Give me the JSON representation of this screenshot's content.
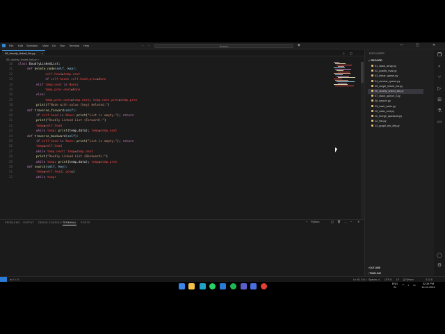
{
  "menu": [
    "File",
    "Edit",
    "Selection",
    "View",
    "Go",
    "Run",
    "Terminal",
    "Help"
  ],
  "search": {
    "placeholder": "Search"
  },
  "tab": {
    "label": "06_doubly_linked_list.py",
    "close": "×"
  },
  "breadcrumb": "06_doubly_linked_list.py > ...",
  "code_lines": [
    {
      "n": "10",
      "indent": 0,
      "segs": [
        [
          "class ",
          "#c586c0"
        ],
        [
          "DoublyLinkedList",
          ""
        ],
        [
          ":",
          "#e6e6e6"
        ]
      ]
    },
    {
      "n": "11",
      "indent": 1,
      "segs": [
        [
          "def ",
          "#c586c0"
        ],
        [
          "delete_node",
          "#dcdcaa"
        ],
        [
          "(self, key):",
          "#9cdcfe"
        ]
      ]
    },
    {
      "n": "12",
      "indent": 3,
      "segs": [
        [
          "self.head",
          "#f44747"
        ],
        [
          "=",
          "#e6e6e6"
        ],
        [
          "temp.next",
          "#f44747"
        ]
      ]
    },
    {
      "n": "13",
      "indent": 3,
      "segs": [
        [
          "if ",
          "#c586c0"
        ],
        [
          "self.head",
          "#f44747"
        ],
        [
          ": ",
          ""
        ],
        [
          "self.head.prev",
          "#f44747"
        ],
        [
          "=",
          ""
        ],
        [
          "None",
          "#f44747"
        ]
      ]
    },
    {
      "n": "14",
      "indent": 2,
      "segs": [
        [
          "elif ",
          "#c586c0"
        ],
        [
          "temp.next ",
          "#f44747"
        ],
        [
          "is ",
          "#c586c0"
        ],
        [
          "None",
          "#f44747"
        ],
        [
          ":",
          ""
        ]
      ]
    },
    {
      "n": "15",
      "indent": 3,
      "segs": [
        [
          "temp.prev.next",
          "#f44747"
        ],
        [
          "=",
          ""
        ],
        [
          "None",
          "#f44747"
        ]
      ]
    },
    {
      "n": "16",
      "indent": 2,
      "segs": [
        [
          "else",
          "#c586c0"
        ],
        [
          ":",
          ""
        ]
      ]
    },
    {
      "n": "17",
      "indent": 3,
      "segs": [
        [
          "temp.prev.next",
          "#f44747"
        ],
        [
          "=",
          ""
        ],
        [
          "temp.next",
          "#f44747"
        ],
        [
          "; ",
          ""
        ],
        [
          "temp.next.prev",
          "#f44747"
        ],
        [
          "=",
          ""
        ],
        [
          "temp.prev",
          "#f44747"
        ]
      ]
    },
    {
      "n": "18",
      "indent": 2,
      "segs": [
        [
          "print",
          "#dcdcaa"
        ],
        [
          "(",
          ""
        ],
        [
          "f\"Node with value {key} deleted.\"",
          "#ce9178"
        ],
        [
          ")",
          ""
        ]
      ]
    },
    {
      "n": "19",
      "indent": 1,
      "segs": [
        [
          "def ",
          "#c586c0"
        ],
        [
          "traverse_forward",
          "#dcdcaa"
        ],
        [
          "(self):",
          "#9cdcfe"
        ]
      ]
    },
    {
      "n": "20",
      "indent": 2,
      "segs": [
        [
          "if ",
          "#c586c0"
        ],
        [
          "self.head ",
          "#f44747"
        ],
        [
          "is ",
          "#c586c0"
        ],
        [
          "None",
          "#f44747"
        ],
        [
          ": ",
          ""
        ],
        [
          "print",
          "#dcdcaa"
        ],
        [
          "(",
          ""
        ],
        [
          "\"List is empty.\"",
          "#ce9178"
        ],
        [
          "); ",
          ""
        ],
        [
          "return",
          "#c586c0"
        ]
      ]
    },
    {
      "n": "21",
      "indent": 2,
      "segs": [
        [
          "print",
          "#dcdcaa"
        ],
        [
          "(",
          ""
        ],
        [
          "\"Doubly Linked List (Forward):\"",
          "#ce9178"
        ],
        [
          ")",
          ""
        ]
      ]
    },
    {
      "n": "22",
      "indent": 2,
      "segs": [
        [
          "temp",
          "#f44747"
        ],
        [
          "=",
          ""
        ],
        [
          "self.head",
          "#f44747"
        ]
      ]
    },
    {
      "n": "23",
      "indent": 2,
      "segs": [
        [
          "while ",
          "#c586c0"
        ],
        [
          "temp",
          "#f44747"
        ],
        [
          ": ",
          ""
        ],
        [
          "print",
          "#dcdcaa"
        ],
        [
          "(temp.data); ",
          ""
        ],
        [
          "temp",
          "#f44747"
        ],
        [
          "=",
          ""
        ],
        [
          "temp.next",
          "#f44747"
        ]
      ]
    },
    {
      "n": "24",
      "indent": 1,
      "segs": [
        [
          "def ",
          "#c586c0"
        ],
        [
          "traverse_backward",
          "#dcdcaa"
        ],
        [
          "(self):",
          "#9cdcfe"
        ]
      ]
    },
    {
      "n": "25",
      "indent": 2,
      "segs": [
        [
          "if ",
          "#c586c0"
        ],
        [
          "self.head ",
          "#f44747"
        ],
        [
          "is ",
          "#c586c0"
        ],
        [
          "None",
          "#f44747"
        ],
        [
          ": ",
          ""
        ],
        [
          "print",
          "#dcdcaa"
        ],
        [
          "(",
          ""
        ],
        [
          "\"List is empty.\"",
          "#ce9178"
        ],
        [
          "); ",
          ""
        ],
        [
          "return",
          "#c586c0"
        ]
      ]
    },
    {
      "n": "26",
      "indent": 2,
      "segs": [
        [
          "temp",
          "#f44747"
        ],
        [
          "=",
          ""
        ],
        [
          "self.head",
          "#f44747"
        ]
      ]
    },
    {
      "n": "27",
      "indent": 2,
      "segs": [
        [
          "while ",
          "#c586c0"
        ],
        [
          "temp.next",
          "#f44747"
        ],
        [
          ": ",
          ""
        ],
        [
          "temp",
          "#f44747"
        ],
        [
          "=",
          ""
        ],
        [
          "temp.next",
          "#f44747"
        ]
      ]
    },
    {
      "n": "28",
      "indent": 2,
      "segs": [
        [
          "print",
          "#dcdcaa"
        ],
        [
          "(",
          ""
        ],
        [
          "\"Doubly Linked List (Backward):\"",
          "#ce9178"
        ],
        [
          ")",
          ""
        ]
      ]
    },
    {
      "n": "29",
      "indent": 2,
      "segs": [
        [
          "while ",
          "#c586c0"
        ],
        [
          "temp",
          "#f44747"
        ],
        [
          ": ",
          ""
        ],
        [
          "print",
          "#dcdcaa"
        ],
        [
          "(temp.data); ",
          ""
        ],
        [
          "temp",
          "#f44747"
        ],
        [
          "=",
          ""
        ],
        [
          "temp.prev",
          "#f44747"
        ]
      ]
    },
    {
      "n": "30",
      "indent": 1,
      "segs": [
        [
          "def ",
          "#c586c0"
        ],
        [
          "search",
          "#dcdcaa"
        ],
        [
          "(self, key):",
          "#9cdcfe"
        ]
      ]
    },
    {
      "n": "31",
      "indent": 2,
      "segs": [
        [
          "temp",
          "#f44747"
        ],
        [
          "=",
          ""
        ],
        [
          "self.head",
          "#f44747"
        ],
        [
          "; ",
          ""
        ],
        [
          "pos",
          "#f44747"
        ],
        [
          "=",
          ""
        ],
        [
          "1",
          "#b5cea8"
        ]
      ]
    },
    {
      "n": "32",
      "indent": 2,
      "segs": [
        [
          "while ",
          "#c586c0"
        ],
        [
          "temp",
          "#f44747"
        ],
        [
          ":",
          ""
        ]
      ]
    }
  ],
  "panel": {
    "tabs": [
      "PROBLEMS",
      "OUTPUT",
      "DEBUG CONSOLE",
      "TERMINAL",
      "PORTS"
    ],
    "active": "TERMINAL",
    "shell": "Python"
  },
  "explorer": {
    "title": "EXPLORER",
    "folder": "RECORD",
    "files": [
      "01_stack_array.py",
      "02_postfix_eval.py",
      "03_linear_queue.py",
      "04_circular_queue.py",
      "05_single_linked_list.py",
      "06_doubly_linked_list.py",
      "07_stack_queue_ll.py",
      "08_search.py",
      "09_hash_table.py",
      "10_radix_sort.py",
      "11_merge_quicksort.py",
      "12_bst.py",
      "13_graph_bfs_dfs.py"
    ],
    "selected": "06_doubly_linked_list.py",
    "outline": "OUTLINE",
    "timeline": "TIMELINE"
  },
  "status": {
    "left": "⊗ 0 ⚠ 0",
    "position": "Ln 45, Col 1",
    "spaces": "Spaces: 4",
    "encoding": "UTF-8",
    "eol": "LF",
    "lang": "{} Python",
    "version": "3.12.6"
  },
  "taskbar": {
    "lang": "ENG",
    "region": "IN",
    "time": "02:34 PM",
    "date": "14-11-2024"
  },
  "colors": {
    "accent": "#2a7bd6",
    "keyword": "#c586c0",
    "function": "#dcdcaa",
    "string": "#ce9178",
    "variable": "#f44747"
  },
  "icons": [
    "vscode-icon",
    "search-icon",
    "explorer-icon",
    "source-control-icon",
    "run-debug-icon",
    "extensions-icon",
    "account-icon",
    "settings-icon",
    "windows-start-icon",
    "file-explorer-icon",
    "edge-icon",
    "whatsapp-icon",
    "vscode-taskbar-icon",
    "spotify-icon",
    "teams-icon",
    "mail-icon",
    "chrome-icon"
  ]
}
